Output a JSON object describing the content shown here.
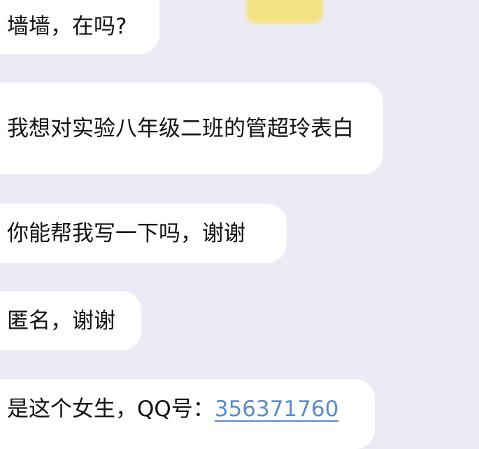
{
  "messages": [
    {
      "text": "墙墙，在吗?"
    },
    {
      "text": "我想对实验八年级二班的管超玲表白"
    },
    {
      "text": "你能帮我写一下吗，谢谢"
    },
    {
      "text": "匿名，谢谢"
    },
    {
      "text": "是这个女生，QQ号：",
      "link": "356371760"
    }
  ],
  "colors": {
    "background": "#ebebf5",
    "bubble": "#ffffff",
    "link": "#5b8cc6",
    "avatar": "#f7e27c"
  }
}
